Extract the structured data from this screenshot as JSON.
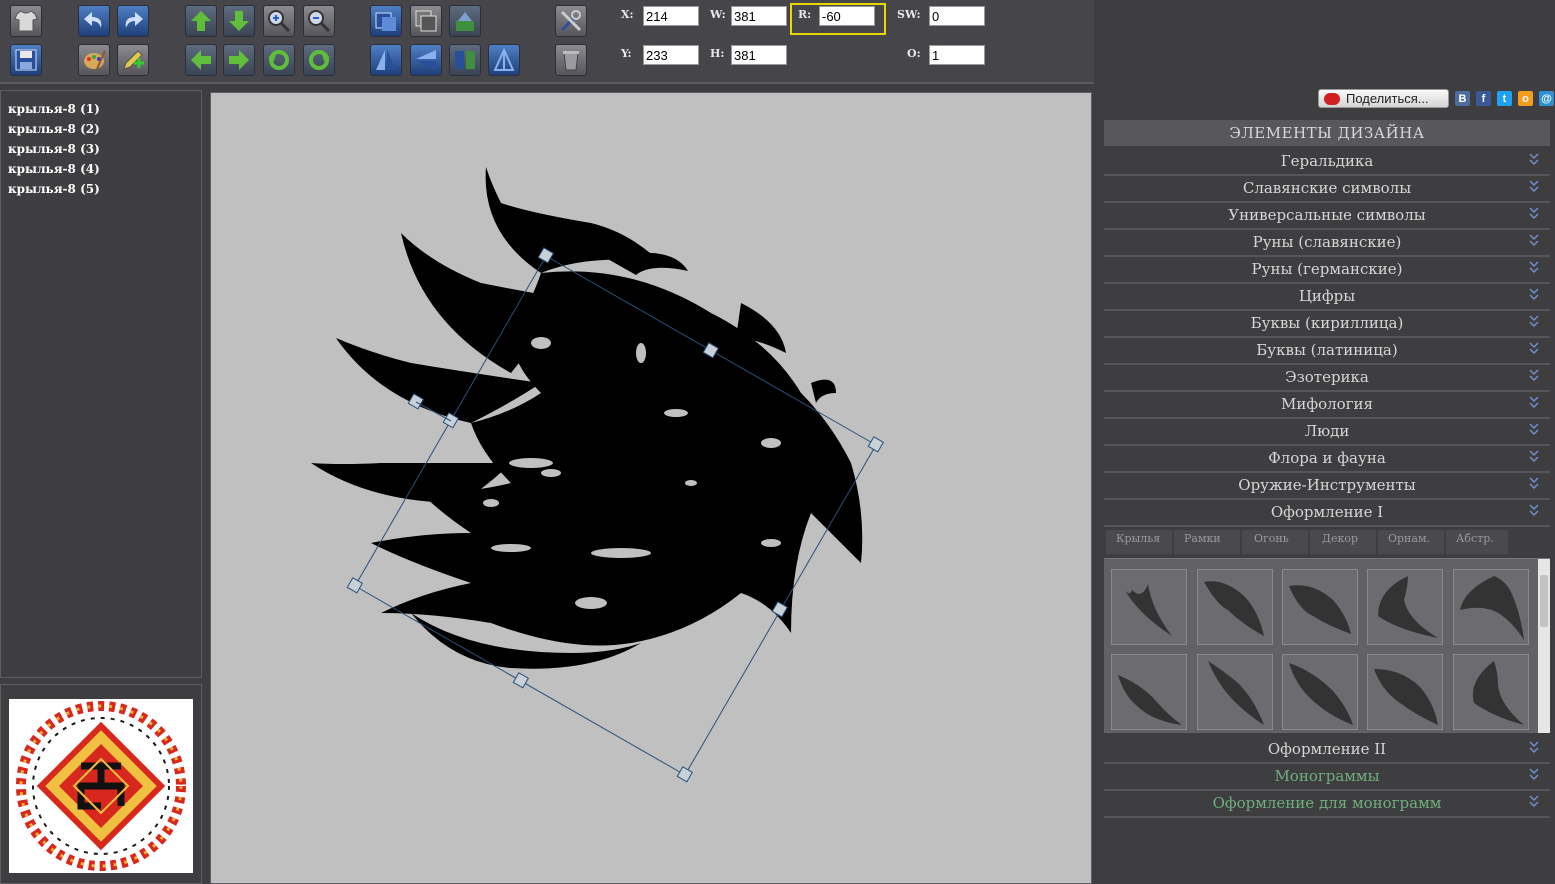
{
  "toolbar": {
    "icons_row1": [
      "tshirt-icon",
      "undo-icon",
      "redo-icon",
      "move-up-icon",
      "move-down-icon",
      "zoom-in-icon",
      "zoom-out-icon",
      "bring-front-icon",
      "send-back-icon",
      "align-icon",
      "settings-tools-icon"
    ],
    "icons_row2": [
      "save-icon",
      "palette-icon",
      "edit-color-icon",
      "move-left-icon",
      "move-right-icon",
      "rotate-ccw-icon",
      "rotate-cw-icon",
      "flip-horizontal-icon",
      "flip-vertical-icon",
      "mirror-icon",
      "trash-icon"
    ],
    "fields": {
      "x_label": "X:",
      "x_value": "214",
      "y_label": "Y:",
      "y_value": "233",
      "w_label": "W:",
      "w_value": "381",
      "h_label": "H:",
      "h_value": "381",
      "r_label": "R:",
      "r_value": "-60",
      "sw_label": "SW:",
      "sw_value": "0",
      "o_label": "O:",
      "o_value": "1"
    }
  },
  "layers": [
    "крылья-8 (1)",
    "крылья-8 (2)",
    "крылья-8 (3)",
    "крылья-8 (4)",
    "крылья-8 (5)"
  ],
  "share": {
    "label": "Поделиться..."
  },
  "social": [
    "В",
    "f",
    "t",
    "о",
    "@"
  ],
  "social_colors": [
    "#4b6e9e",
    "#3b5998",
    "#1da1f2",
    "#f29b1d",
    "#2d8fd6"
  ],
  "panel": {
    "header": "ЭЛЕМЕНТЫ ДИЗАЙНА",
    "categories": [
      "Геральдика",
      "Славянские символы",
      "Универсальные символы",
      "Руны (славянские)",
      "Руны (германские)",
      "Цифры",
      "Буквы (кириллица)",
      "Буквы (латиница)",
      "Эзотерика",
      "Мифология",
      "Люди",
      "Флора и фауна",
      "Оружие-Инструменты",
      "Оформление I"
    ],
    "subtabs": [
      "Крылья",
      "Рамки",
      "Огонь",
      "Декор",
      "Орнам.",
      "Абстр."
    ],
    "bottom_categories": [
      "Оформление II",
      "Монограммы",
      "Оформление для монограмм"
    ]
  }
}
